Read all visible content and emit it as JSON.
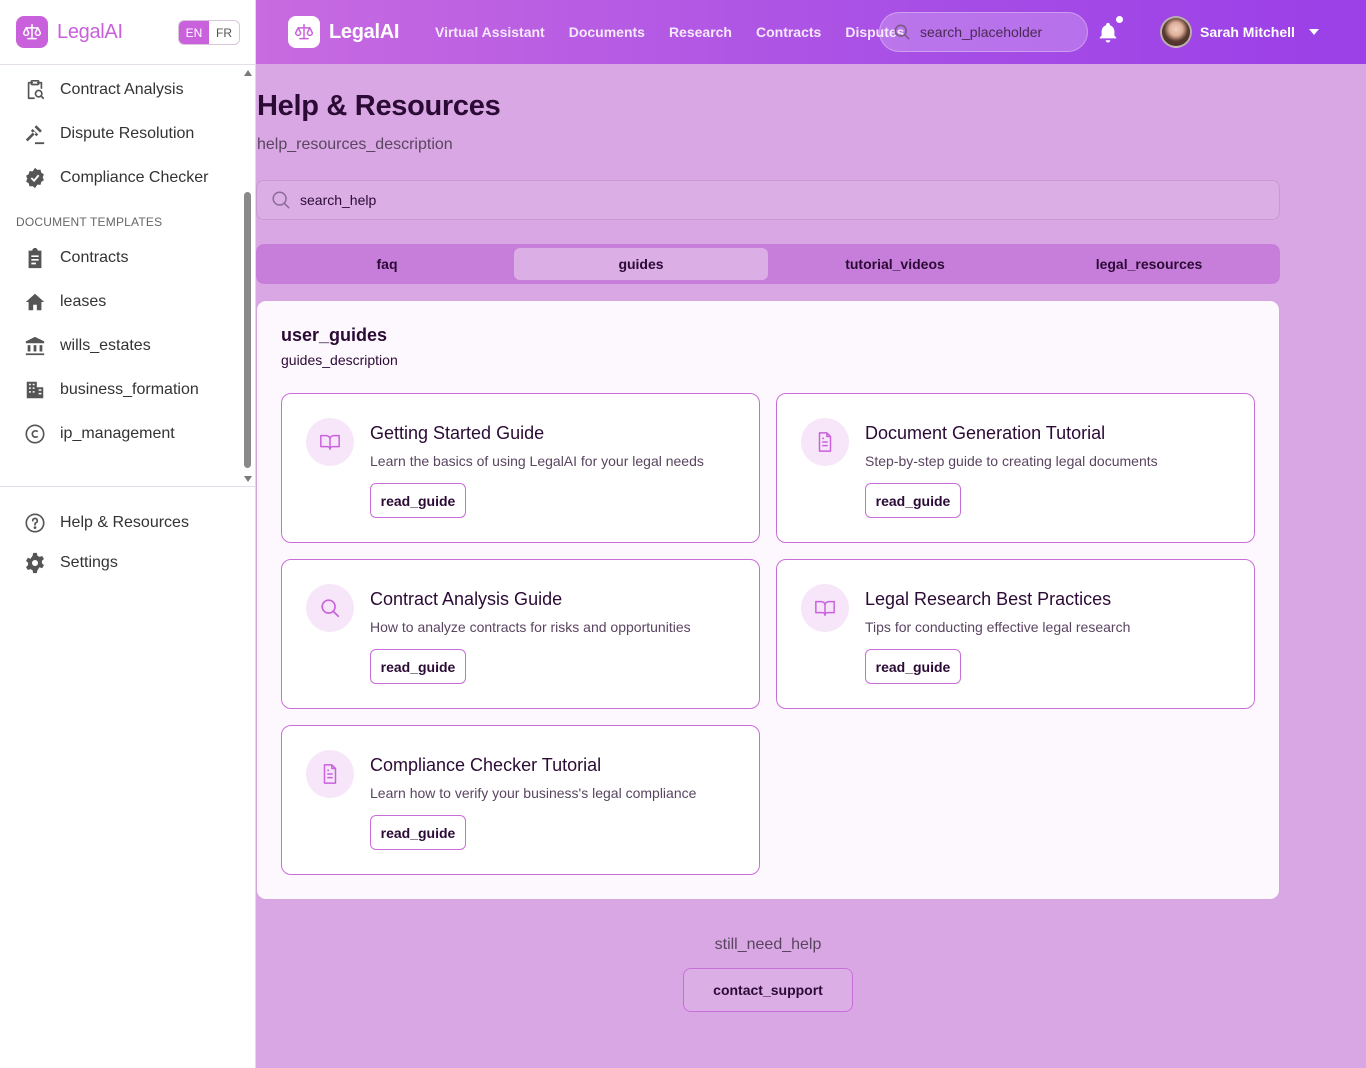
{
  "sidebar": {
    "brand": "LegalAI",
    "languages": [
      "EN",
      "FR"
    ],
    "items": [
      {
        "label": "Contract Analysis"
      },
      {
        "label": "Dispute Resolution"
      },
      {
        "label": "Compliance Checker"
      }
    ],
    "templates_heading": "DOCUMENT TEMPLATES",
    "templates": [
      {
        "label": "Contracts"
      },
      {
        "label": "leases"
      },
      {
        "label": "wills_estates"
      },
      {
        "label": "business_formation"
      },
      {
        "label": "ip_management"
      }
    ],
    "bottom": [
      {
        "label": "Help & Resources"
      },
      {
        "label": "Settings"
      }
    ]
  },
  "header": {
    "brand": "LegalAI",
    "nav": [
      "Virtual Assistant",
      "Documents",
      "Research",
      "Contracts",
      "Disputes"
    ],
    "search_placeholder": "search_placeholder",
    "user_name": "Sarah Mitchell"
  },
  "main": {
    "title": "Help & Resources",
    "description": "help_resources_description",
    "search_placeholder": "search_help",
    "tabs": [
      "faq",
      "guides",
      "tutorial_videos",
      "legal_resources"
    ],
    "active_tab": "guides",
    "panel": {
      "title": "user_guides",
      "description": "guides_description",
      "guides": [
        {
          "title": "Getting Started Guide",
          "description": "Learn the basics of using LegalAI for your legal needs",
          "button": "read_guide",
          "icon": "book-icon"
        },
        {
          "title": "Document Generation Tutorial",
          "description": "Step-by-step guide to creating legal documents",
          "button": "read_guide",
          "icon": "document-icon"
        },
        {
          "title": "Contract Analysis Guide",
          "description": "How to analyze contracts for risks and opportunities",
          "button": "read_guide",
          "icon": "search-icon"
        },
        {
          "title": "Legal Research Best Practices",
          "description": "Tips for conducting effective legal research",
          "button": "read_guide",
          "icon": "book-icon"
        },
        {
          "title": "Compliance Checker Tutorial",
          "description": "Learn how to verify your business's legal compliance",
          "button": "read_guide",
          "icon": "document-icon"
        }
      ]
    },
    "still_need_help": "still_need_help",
    "contact_button": "contact_support"
  },
  "colors": {
    "accent": "#c960dc",
    "background": "#d9a8e4",
    "header_gradient_start": "#c86be0",
    "header_gradient_end": "#9b3fe7",
    "card_border": "#c96ed9"
  }
}
